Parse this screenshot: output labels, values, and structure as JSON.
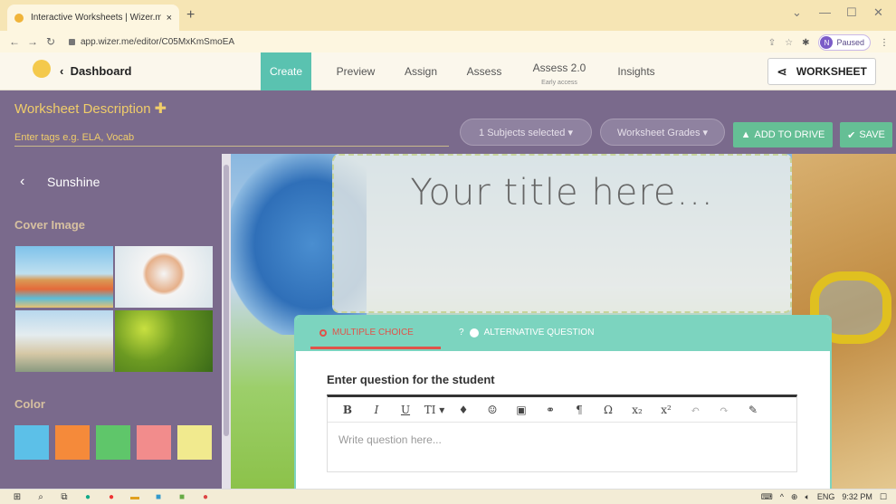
{
  "browser": {
    "tab_title": "Interactive Worksheets | Wizer.m",
    "tab_close": "×",
    "new_tab": "+",
    "url": "app.wizer.me/editor/C05MxKmSmoEA",
    "profile_initial": "N",
    "profile_status": "Paused",
    "window_controls": [
      "⌄",
      "—",
      "☐",
      "✕"
    ]
  },
  "header": {
    "dashboard_label": "Dashboard",
    "tabs": [
      {
        "label": "Create",
        "sub": ""
      },
      {
        "label": "Preview",
        "sub": ""
      },
      {
        "label": "Assign",
        "sub": ""
      },
      {
        "label": "Assess",
        "sub": ""
      },
      {
        "label": "Assess 2.0",
        "sub": "Early access"
      },
      {
        "label": "Insights",
        "sub": ""
      }
    ],
    "worksheet_label": "WORKSHEET"
  },
  "toolbar": {
    "worksheet_description": "Worksheet Description",
    "tags_placeholder": "Enter tags e.g. ELA, Vocab",
    "subjects": "1 Subjects selected ▾",
    "grades": "Worksheet Grades ▾",
    "add_to_drive": "ADD TO DRIVE",
    "save": "SAVE"
  },
  "sidebar": {
    "theme_name": "Sunshine",
    "cover_image_label": "Cover Image",
    "color_label": "Color",
    "colors": [
      "#5cc0e8",
      "#f58a3a",
      "#5fc66a",
      "#f28c8c",
      "#f1ea8e"
    ]
  },
  "main": {
    "title_placeholder": "Your title here...",
    "question_tabs": [
      "MULTIPLE CHOICE",
      "ALTERNATIVE QUESTION"
    ],
    "question_label": "Enter question for the student",
    "question_placeholder": "Write question here...",
    "editor_tools": [
      "B",
      "I",
      "U",
      "TI ▾",
      "♦",
      "☺",
      "▣",
      "⚭",
      "¶",
      "Ω",
      "x₂",
      "x²",
      "↶",
      "↷",
      "✎"
    ]
  },
  "taskbar": {
    "lang": "ENG",
    "time": "9:32 PM"
  }
}
